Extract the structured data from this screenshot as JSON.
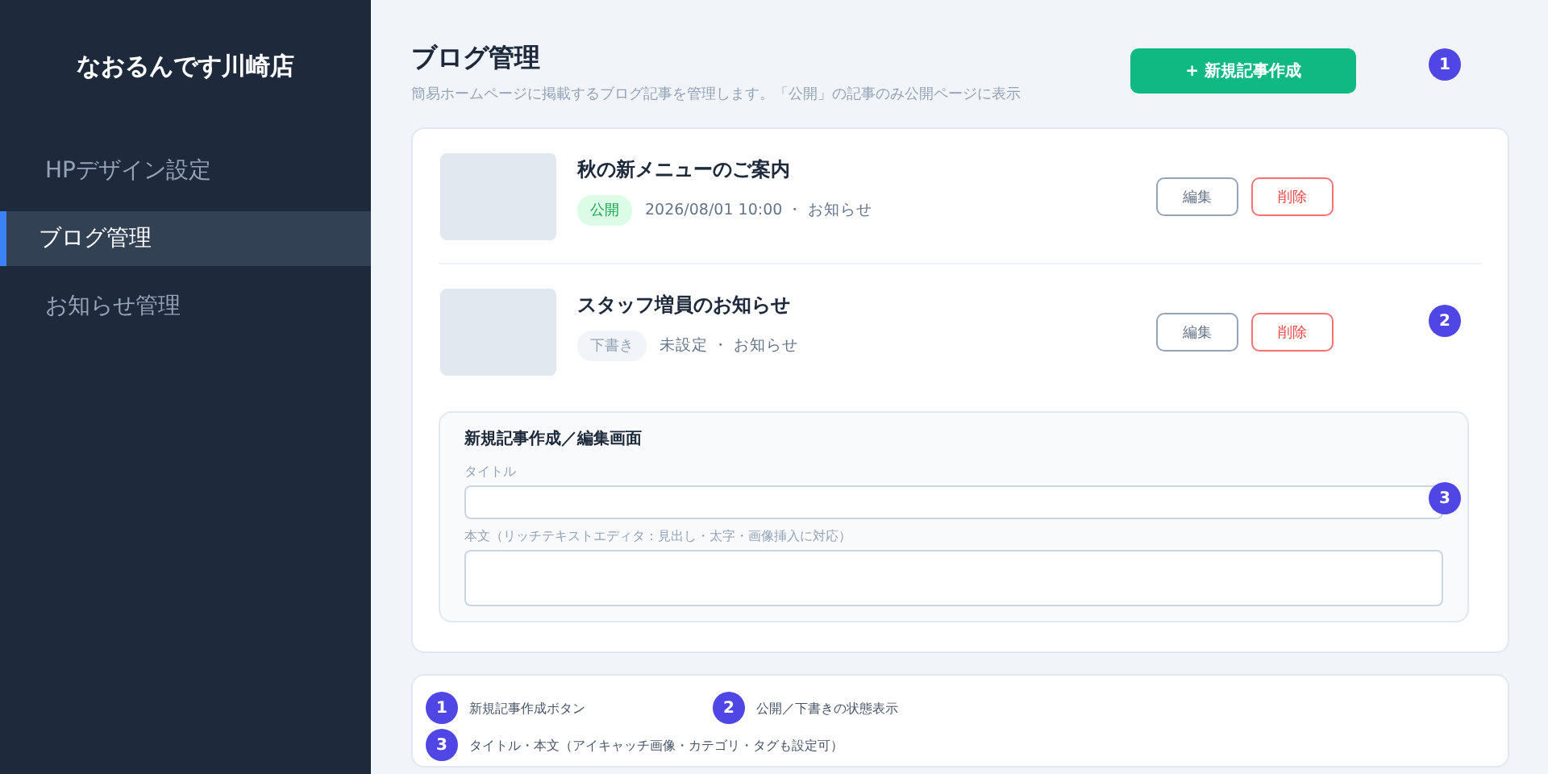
{
  "sidebar": {
    "store_name": "なおるんです川崎店",
    "items": [
      {
        "label": "HPデザイン設定",
        "selected": false
      },
      {
        "label": "ブログ管理",
        "selected": true
      },
      {
        "label": "お知らせ管理",
        "selected": false
      }
    ]
  },
  "header": {
    "title": "ブログ管理",
    "description": "簡易ホームページに掲載するブログ記事を管理します。「公開」の記事のみ公開ページに表示",
    "new_button": "+ 新規記事作成"
  },
  "posts": [
    {
      "title": "秋の新メニューのご案内",
      "status": "公開",
      "kind": "published",
      "meta": "2026/08/01 10:00 ・ お知らせ",
      "edit": "編集",
      "delete": "削除"
    },
    {
      "title": "スタッフ増員のお知らせ",
      "status": "下書き",
      "kind": "draft",
      "meta": "未設定 ・ お知らせ",
      "edit": "編集",
      "delete": "削除"
    }
  ],
  "editor": {
    "heading": "新規記事作成／編集画面",
    "fields": [
      {
        "label": "タイトル",
        "kind": "text"
      },
      {
        "label": "本文（リッチテキストエディタ：見出し・太字・画像挿入に対応）",
        "kind": "textarea"
      }
    ]
  },
  "markers": [
    {
      "number": "1"
    },
    {
      "number": "2"
    },
    {
      "number": "3"
    }
  ],
  "legend": [
    {
      "number": "1",
      "text": "新規記事作成ボタン"
    },
    {
      "number": "2",
      "text": "公開／下書きの状態表示"
    },
    {
      "number": "3",
      "text": "タイトル・本文（アイキャッチ画像・カテゴリ・タグも設定可）"
    }
  ]
}
